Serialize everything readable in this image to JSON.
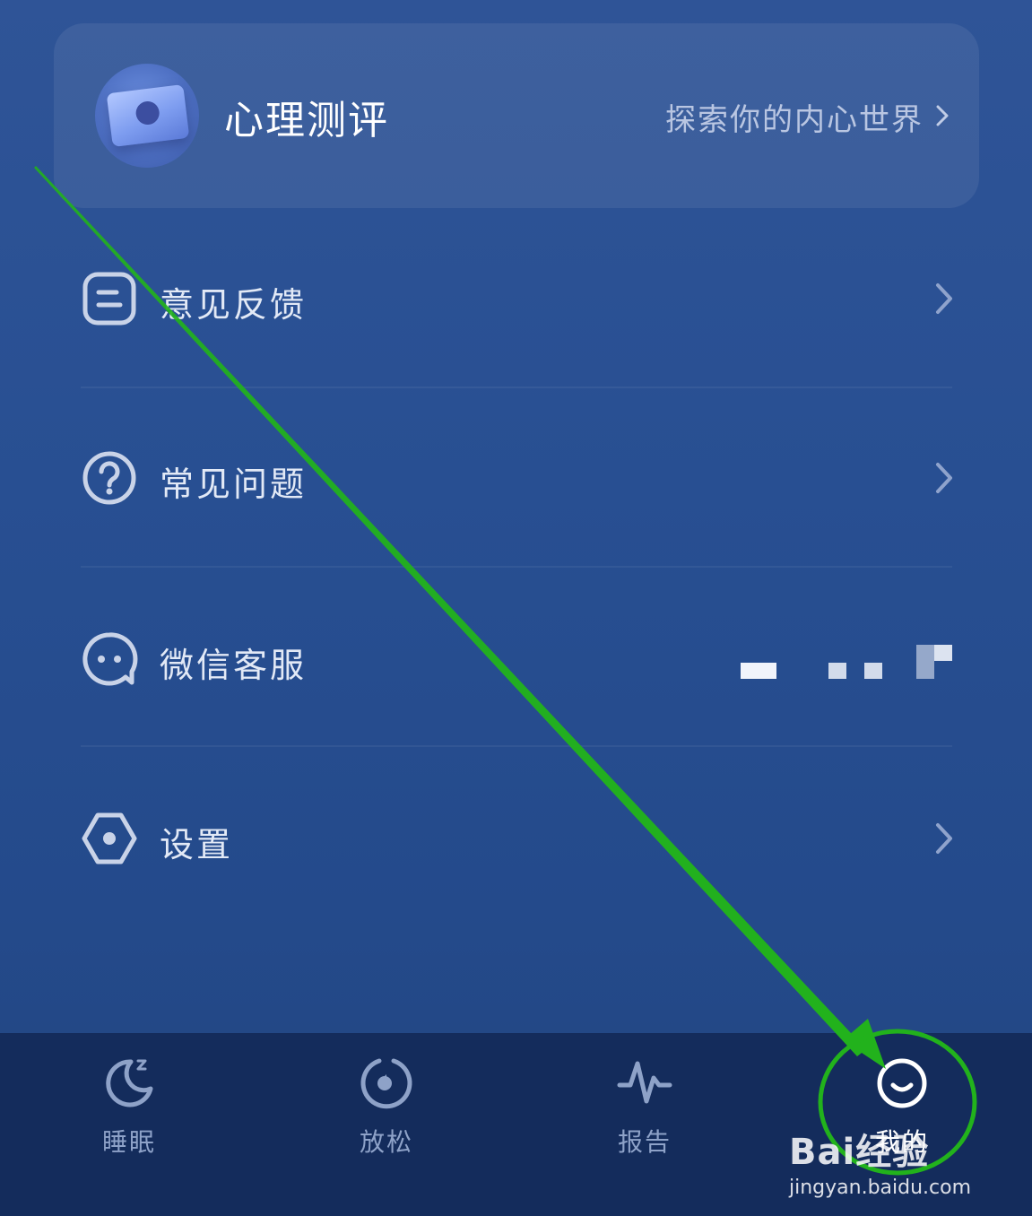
{
  "card": {
    "title": "心理测评",
    "subtitle": "探索你的内心世界",
    "avatar_icon": "profile-photo-icon"
  },
  "menu": {
    "items": [
      {
        "label": "意见反馈",
        "icon": "feedback-icon"
      },
      {
        "label": "常见问题",
        "icon": "question-icon"
      },
      {
        "label": "微信客服",
        "icon": "chat-bubble-icon"
      },
      {
        "label": "设置",
        "icon": "settings-icon"
      }
    ]
  },
  "tabbar": {
    "tabs": [
      {
        "label": "睡眠",
        "icon": "moon-sleep-icon"
      },
      {
        "label": "放松",
        "icon": "relax-timer-icon"
      },
      {
        "label": "报告",
        "icon": "pulse-report-icon"
      },
      {
        "label": "我的",
        "icon": "smile-profile-icon",
        "active": true
      }
    ]
  },
  "colors": {
    "background": "#2a5092",
    "tabbar": "#142c5c",
    "annotation_green": "#22b21c"
  },
  "watermark": {
    "brand": "Bai经验",
    "site": "jingyan.baidu.com"
  }
}
